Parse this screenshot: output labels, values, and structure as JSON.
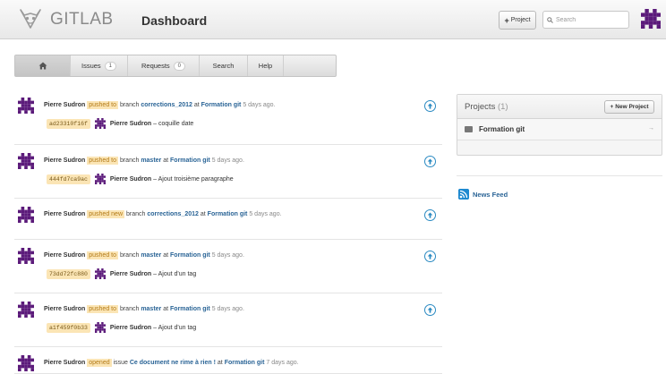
{
  "header": {
    "brand": "GITLAB",
    "page_title": "Dashboard",
    "new_project_label": "Project",
    "search_placeholder": "Search"
  },
  "nav": {
    "home_icon": "home-icon",
    "issues_label": "Issues",
    "issues_count": "1",
    "requests_label": "Requests",
    "requests_count": "0",
    "search_label": "Search",
    "help_label": "Help"
  },
  "feed": [
    {
      "user": "Pierre Sudron",
      "action": "pushed to",
      "pre": "branch",
      "ref": "corrections_2012",
      "mid": "at",
      "project": "Formation git",
      "time": "5 days ago.",
      "sha": "ad23310f16f",
      "author": "Pierre Sudron",
      "message": "– coquille date"
    },
    {
      "user": "Pierre Sudron",
      "action": "pushed to",
      "pre": "branch",
      "ref": "master",
      "mid": "at",
      "project": "Formation git",
      "time": "5 days ago.",
      "sha": "444fd7ca9ac",
      "author": "Pierre Sudron",
      "message": "– Ajout troisième paragraphe"
    },
    {
      "user": "Pierre Sudron",
      "action": "pushed new",
      "pre": "branch",
      "ref": "corrections_2012",
      "mid": "at",
      "project": "Formation git",
      "time": "5 days ago."
    },
    {
      "user": "Pierre Sudron",
      "action": "pushed to",
      "pre": "branch",
      "ref": "master",
      "mid": "at",
      "project": "Formation git",
      "time": "5 days ago.",
      "sha": "73dd72fc880",
      "author": "Pierre Sudron",
      "message": "– Ajout d'un tag"
    },
    {
      "user": "Pierre Sudron",
      "action": "pushed to",
      "pre": "branch",
      "ref": "master",
      "mid": "at",
      "project": "Formation git",
      "time": "5 days ago.",
      "sha": "a1f459f0b33",
      "author": "Pierre Sudron",
      "message": "– Ajout d'un tag"
    },
    {
      "user": "Pierre Sudron",
      "action": "opened",
      "pre": "issue",
      "ref": "Ce document ne rime à rien !",
      "mid": "at",
      "project": "Formation git",
      "time": "7 days ago."
    }
  ],
  "sidebar": {
    "projects_title": "Projects",
    "projects_count": "(1)",
    "new_project_label": "New Project",
    "project_name": "Formation git",
    "project_arrow": "→",
    "news_feed_label": "News Feed"
  },
  "colors": {
    "accent_link": "#2a6496",
    "action_bg": "#fbe5b5",
    "avatar_purple": "#5b1a7a"
  }
}
